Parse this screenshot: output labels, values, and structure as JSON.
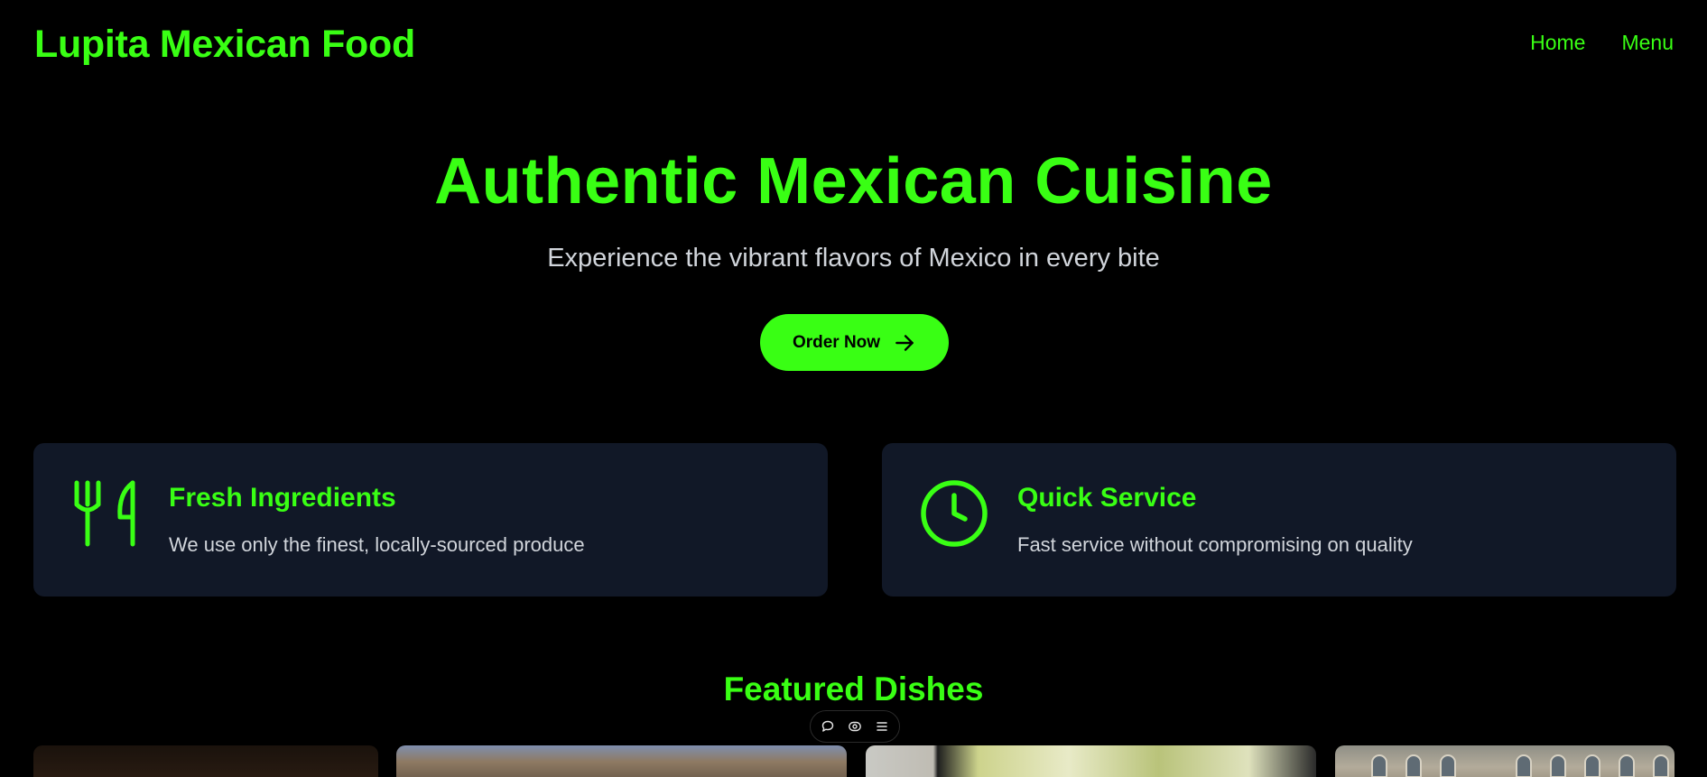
{
  "header": {
    "brand": "Lupita Mexican Food",
    "nav": [
      {
        "label": "Home"
      },
      {
        "label": "Menu"
      }
    ]
  },
  "hero": {
    "title": "Authentic Mexican Cuisine",
    "subtitle": "Experience the vibrant flavors of Mexico in every bite",
    "cta_label": "Order Now",
    "cta_icon": "arrow-right-icon"
  },
  "features": [
    {
      "icon": "utensils-icon",
      "title": "Fresh Ingredients",
      "description": "We use only the finest, locally-sourced produce"
    },
    {
      "icon": "clock-icon",
      "title": "Quick Service",
      "description": "Fast service without compromising on quality"
    }
  ],
  "featured": {
    "title": "Featured Dishes",
    "toolbar_icons": [
      "comment-icon",
      "eye-icon",
      "menu-icon"
    ]
  },
  "colors": {
    "accent": "#39ff14",
    "background": "#000000",
    "card": "#111827",
    "muted_text": "#d1d5db"
  }
}
